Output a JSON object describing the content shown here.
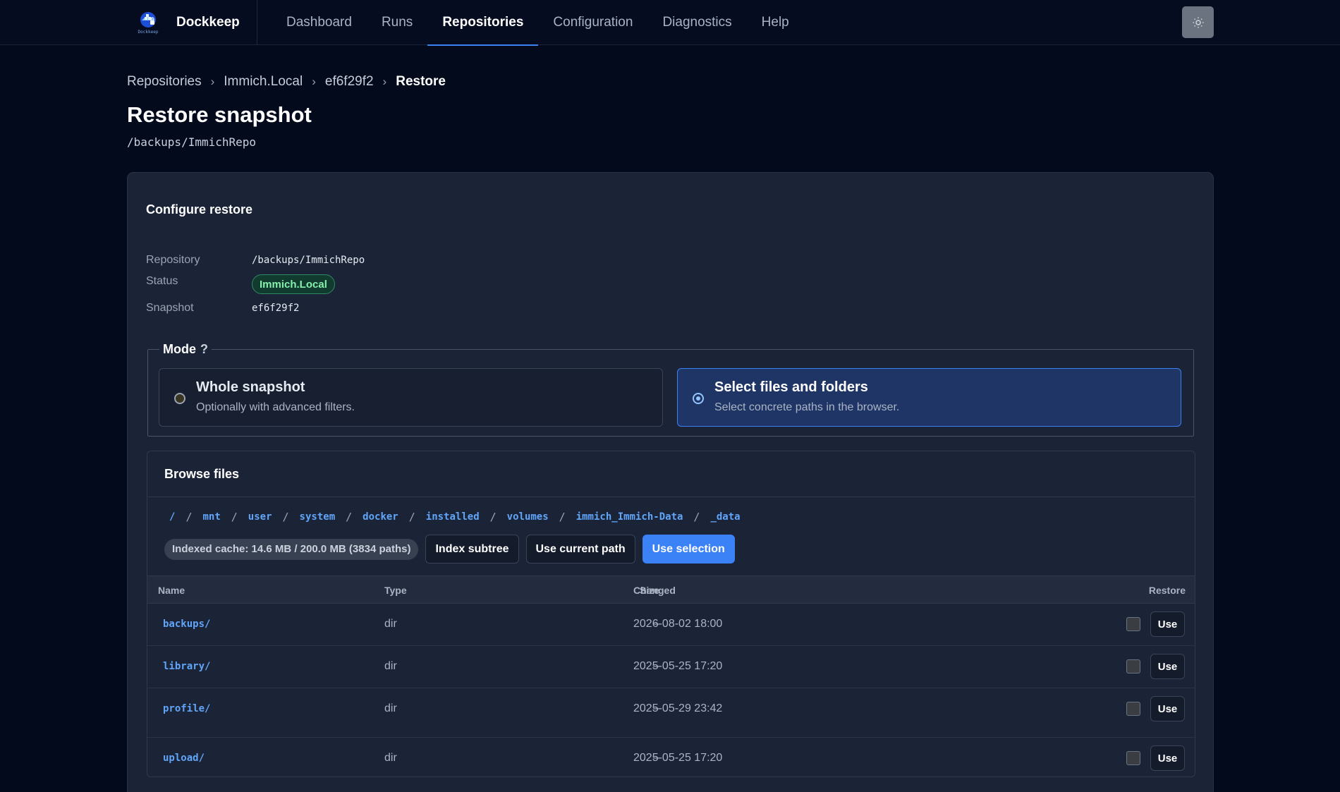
{
  "app": {
    "name": "Dockkeep",
    "logo_text": "Dockkeep"
  },
  "nav": {
    "items": [
      {
        "label": "Dashboard",
        "active": false
      },
      {
        "label": "Runs",
        "active": false
      },
      {
        "label": "Repositories",
        "active": true
      },
      {
        "label": "Configuration",
        "active": false
      },
      {
        "label": "Diagnostics",
        "active": false
      },
      {
        "label": "Help",
        "active": false
      }
    ],
    "theme_icon": "sun-icon"
  },
  "breadcrumb": [
    "Repositories",
    "Immich.Local",
    "ef6f29f2",
    "Restore"
  ],
  "page": {
    "title": "Restore snapshot",
    "subtitle": "/backups/ImmichRepo"
  },
  "card": {
    "title": "Configure restore",
    "repository_label": "Repository",
    "repository_value": "/backups/ImmichRepo",
    "status_label": "Status",
    "status_value": "Immich.Local",
    "snapshot_label": "Snapshot",
    "snapshot_value": "ef6f29f2"
  },
  "mode": {
    "legend": "Mode",
    "help": "?",
    "options": [
      {
        "title": "Whole snapshot",
        "desc": "Optionally with advanced filters.",
        "selected": false
      },
      {
        "title": "Select files and folders",
        "desc": "Select concrete paths in the browser.",
        "selected": true
      }
    ]
  },
  "browse": {
    "title": "Browse files",
    "path": [
      "/",
      "mnt",
      "user",
      "system",
      "docker",
      "installed",
      "volumes",
      "immich_Immich-Data",
      "_data"
    ],
    "cache": "Indexed cache: 14.6 MB / 200.0 MB (3834 paths)",
    "buttons": {
      "index_subtree": "Index subtree",
      "use_current_path": "Use current path",
      "use_selection": "Use selection"
    },
    "columns": {
      "name": "Name",
      "type": "Type",
      "size": "Size",
      "changed": "Changed",
      "restore": "Restore"
    },
    "rows": [
      {
        "name": "backups/",
        "type": "dir",
        "size": "–",
        "changed": "2026-08-02 18:00",
        "use": "Use"
      },
      {
        "name": "library/",
        "type": "dir",
        "size": "–",
        "changed": "2025-05-25 17:20",
        "use": "Use"
      },
      {
        "name": "profile/",
        "type": "dir",
        "size": "–",
        "changed": "2025-05-29 23:42",
        "use": "Use"
      },
      {
        "name": "upload/",
        "type": "dir",
        "size": "–",
        "changed": "2025-05-25 17:20",
        "use": "Use"
      }
    ]
  },
  "colors": {
    "accent": "#3b82f6",
    "background": "#030a1c",
    "card": "#1b2436",
    "badge_text": "#86efac"
  }
}
